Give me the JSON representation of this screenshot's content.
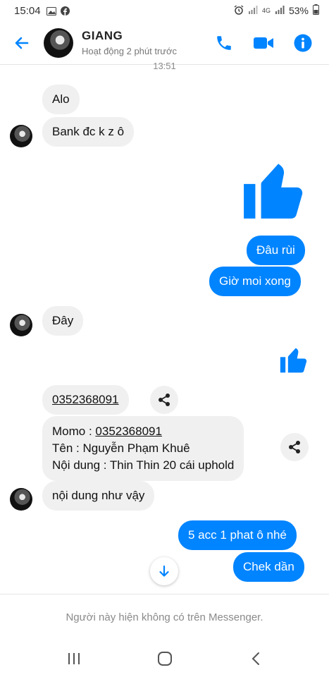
{
  "status_bar": {
    "time": "15:04",
    "network": "4G",
    "battery": "53%"
  },
  "header": {
    "name": "GIANG",
    "status": "Hoạt động 2 phút trước"
  },
  "timestamp": "13:51",
  "messages": {
    "m1": "Alo",
    "m2": "Bank đc k z ô",
    "m3": "Đâu rùi",
    "m4": "Giờ moi xong",
    "m5": "Đây",
    "m6": "0352368091",
    "m7_label": "Momo : ",
    "m7_value": "0352368091",
    "m7_line2": "Tên : Nguyễn Phạm Khuê",
    "m7_line3": "Nội dung : Thin Thin 20 cái uphold",
    "m8": "nội dung như vậy",
    "m9": "5 acc 1 phat ô nhé",
    "m10": "Chek dần"
  },
  "footer": {
    "notice": "Người này hiện không có trên Messenger."
  },
  "colors": {
    "accent": "#0084ff",
    "incoming_bubble": "#f0f0f0"
  }
}
